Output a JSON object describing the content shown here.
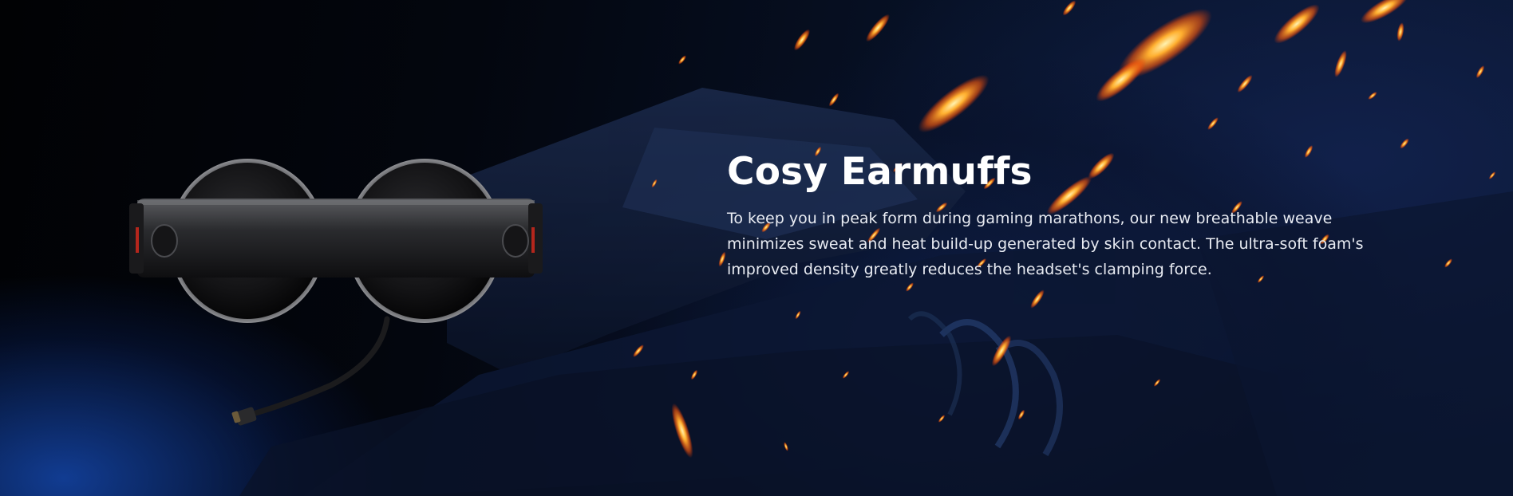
{
  "section": {
    "title": "Cosy Earmuffs",
    "description": "To keep you in peak form during gaming marathons, our new breathable weave minimizes sweat and heat build-up generated by skin contact. The ultra-soft foam's improved density greatly reduces the headset's clamping force."
  },
  "colors": {
    "background_dark": "#03060d",
    "background_blue": "#1446aa",
    "spark_orange": "#ff7a18",
    "spark_yellow": "#ffd36a",
    "text_white": "#ffffff"
  },
  "images": {
    "product": "gaming-headset-top-view",
    "background": "tank-with-flying-sparks"
  }
}
